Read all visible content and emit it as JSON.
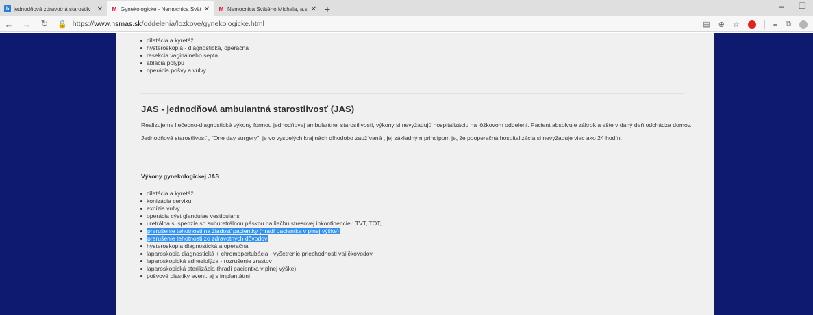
{
  "browser": {
    "tabs": [
      {
        "title": "jednodňová zdravotná starostliv",
        "favicon": "b",
        "favicon_color": "#2a7fd4",
        "active": false
      },
      {
        "title": "Gynekologické - Nemocnica Svät",
        "favicon": "M",
        "favicon_color": "#c8102e",
        "active": true
      },
      {
        "title": "Nemocnica Svätého Michala, a.s.",
        "favicon": "M",
        "favicon_color": "#c8102e",
        "active": false
      }
    ],
    "new_tab": "+",
    "url_prefix": "https://",
    "url_host": "www.nsmas.sk",
    "url_path": "/oddelenia/lozkove/gynekologicke.html"
  },
  "page": {
    "top_list": [
      "dilatácia a kyretáž",
      "hysteroskopia - diagnostická, operačná",
      "resekcia vaginálneho septa",
      "ablácia polypu",
      "operácia pošvy a vulvy"
    ],
    "jas_heading": "JAS - jednodňová ambulantná starostlivosť (JAS)",
    "jas_paragraph": "Realizujeme liečebno-diagnostické výkony formou jednodňovej ambulantnej starostlivosti, výkony si nevyžadujú hospitalizáciu na lôžkovom oddelení. Pacient absolvuje zákrok a ešte v daný deň odchádza domov. Jednodňová starostlivosť , \"One day surgery\", je vo vyspelých krajinách dlhodobo zaužívaná , jej základným princípom je, že pooperačná hospitalizácia si nevyžaduje viac ako 24 hodín.",
    "jas_list_heading": "Výkony gynekologickej JAS",
    "jas_list": [
      {
        "text": "dilatácia a kyretáž",
        "selected": false
      },
      {
        "text": "konizácia cervixu",
        "selected": false
      },
      {
        "text": "excízia vulvy",
        "selected": false
      },
      {
        "text": "operácia cýst glandulae vestibularis",
        "selected": false
      },
      {
        "text": "uretrálna suspenzia so suburetrálnou páskou na liečbu stresovej inkontinencie : TVT, TOT,",
        "selected": false
      },
      {
        "text": "prerušenie tehotnosti na žiadosť pacientky (hradí pacientka v plnej výške)",
        "selected": true
      },
      {
        "text": "prerušenie tehotnosti zo zdravotných dôvodov",
        "selected": true
      },
      {
        "text": "hysteroskopia diagnostická a operačná",
        "selected": false
      },
      {
        "text": "laparoskopia diagnostická + chromopertubácia - vyšetrenie priechodnosti vajíčkovodov",
        "selected": false
      },
      {
        "text": "laparoskopická adheziolýza - rozrušenie zrastov",
        "selected": false
      },
      {
        "text": "laparoskopická sterilizácia  (hradí pacientka v plnej výške)",
        "selected": false
      },
      {
        "text": "pošvové plastiky event. aj s implantátmi",
        "selected": false
      }
    ]
  },
  "colors": {
    "page_background": "#0d1a70",
    "content_background": "#f0f0f0",
    "selection": "#3391f0"
  }
}
